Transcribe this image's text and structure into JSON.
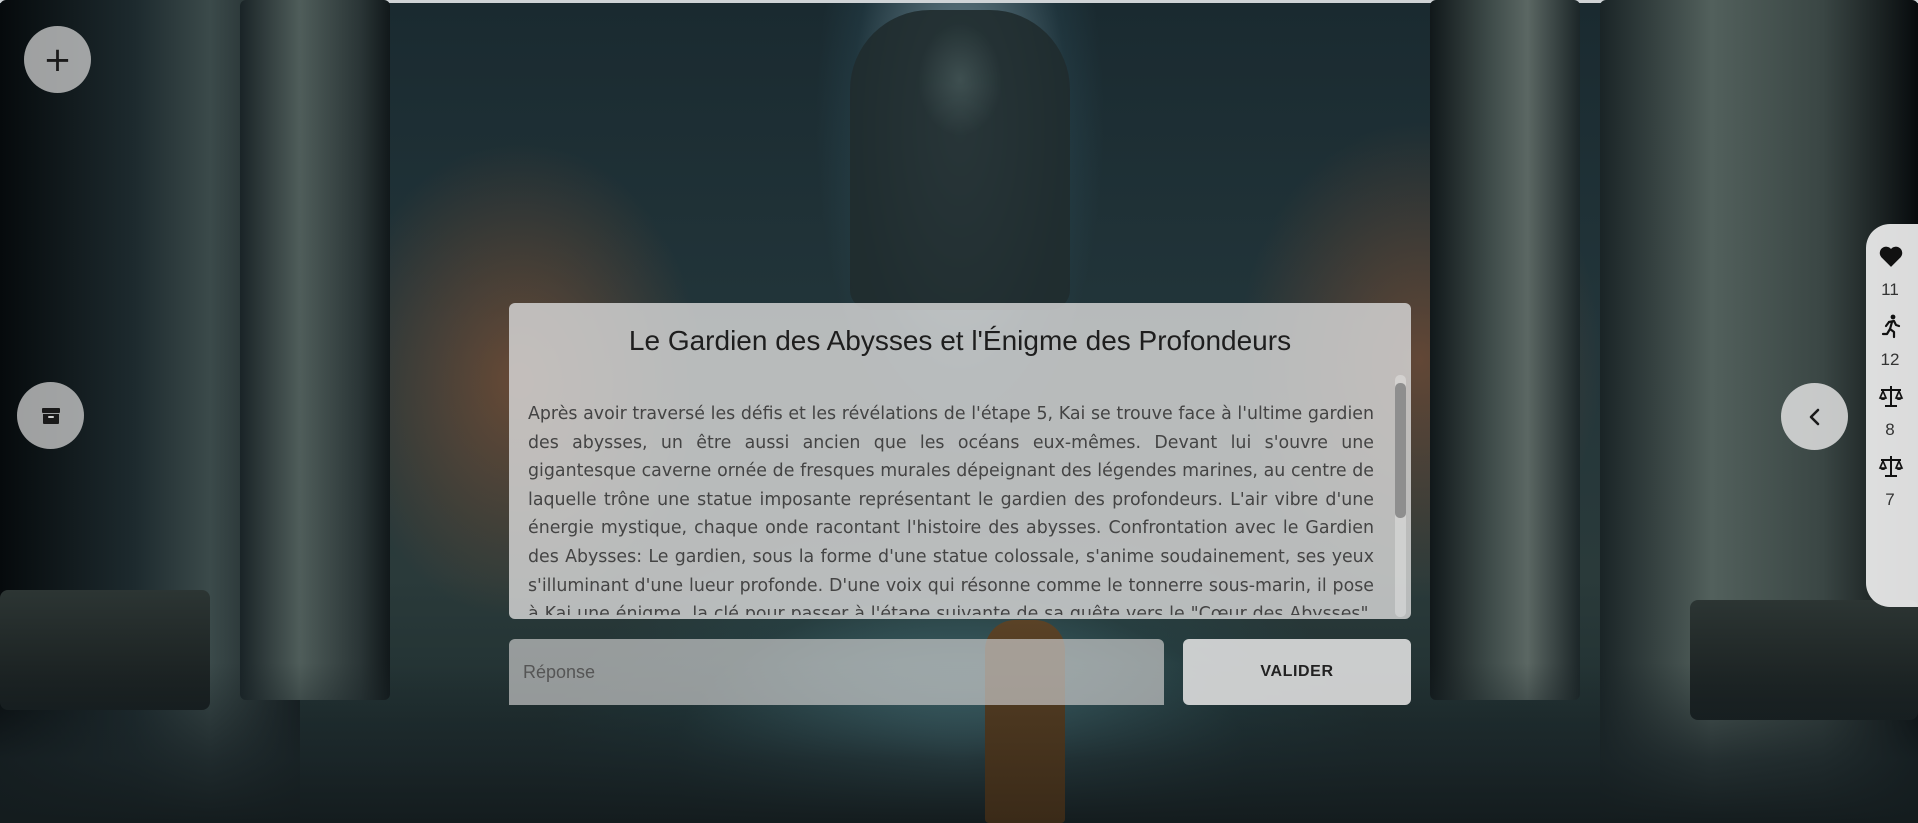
{
  "story": {
    "title": "Le Gardien des Abysses et l'Énigme des Profondeurs",
    "text": "Après avoir traversé les défis et les révélations de l'étape 5, Kai se trouve face à l'ultime gardien des abysses, un être aussi ancien que les océans eux-mêmes. Devant lui s'ouvre une gigantesque caverne ornée de fresques murales dépeignant des légendes marines, au centre de laquelle trône une statue imposante représentant le gardien des profondeurs. L'air vibre d'une énergie mystique, chaque onde racontant l'histoire des abysses. Confrontation avec le Gardien des Abysses: Le gardien, sous la forme d'une statue colossale, s'anime soudainement, ses yeux s'illuminant d'une lueur profonde. D'une voix qui résonne comme le tonnerre sous-marin, il pose à Kai une énigme, la clé pour passer à l'étape suivante de sa quête vers le \"Cœur des Abysses\". La réponse à cette"
  },
  "answer": {
    "placeholder": "Réponse",
    "value": ""
  },
  "validate_label": "VALIDER",
  "left_buttons": [
    {
      "icon": "plus-icon"
    },
    {
      "icon": "archive-icon"
    }
  ],
  "back_button": {
    "icon": "chevron-left-icon"
  },
  "stats": [
    {
      "icon": "heart-icon",
      "value": "11"
    },
    {
      "icon": "running-person-icon",
      "value": "12"
    },
    {
      "icon": "scale-icon",
      "value": "8"
    },
    {
      "icon": "scale-icon",
      "value": "7"
    }
  ]
}
